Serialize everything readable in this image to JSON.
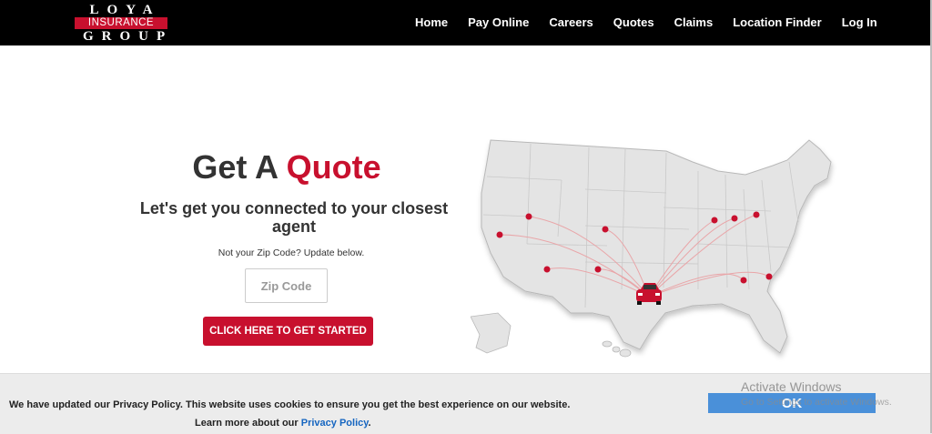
{
  "brand": {
    "top": "LOYA",
    "mid": "INSURANCE",
    "bottom": "GROUP",
    "accent_color": "#c8102e"
  },
  "nav": {
    "items": [
      {
        "label": "Home"
      },
      {
        "label": "Pay Online"
      },
      {
        "label": "Careers"
      },
      {
        "label": "Quotes"
      },
      {
        "label": "Claims"
      },
      {
        "label": "Location Finder"
      },
      {
        "label": "Log In"
      }
    ]
  },
  "hero": {
    "title_prefix": "Get A ",
    "title_accent": "Quote",
    "subtitle": "Let's get you connected to your closest agent",
    "zip_note": "Not your Zip Code? Update below.",
    "zip_placeholder": "Zip Code",
    "zip_value": "",
    "cta_label": "CLICK HERE TO GET STARTED"
  },
  "map": {
    "icon": "us-map-with-car-icon",
    "pin_color": "#c8102e"
  },
  "cookie": {
    "text": "We have updated our Privacy Policy. This website uses cookies to ensure you get the best experience on our website.",
    "learn_prefix": "Learn more about our ",
    "link_label": "Privacy Policy",
    "learn_suffix": ".",
    "ok_label": "OK"
  },
  "watermark": {
    "line1": "Activate Windows",
    "line2": "Go to Settings to activate Windows."
  }
}
